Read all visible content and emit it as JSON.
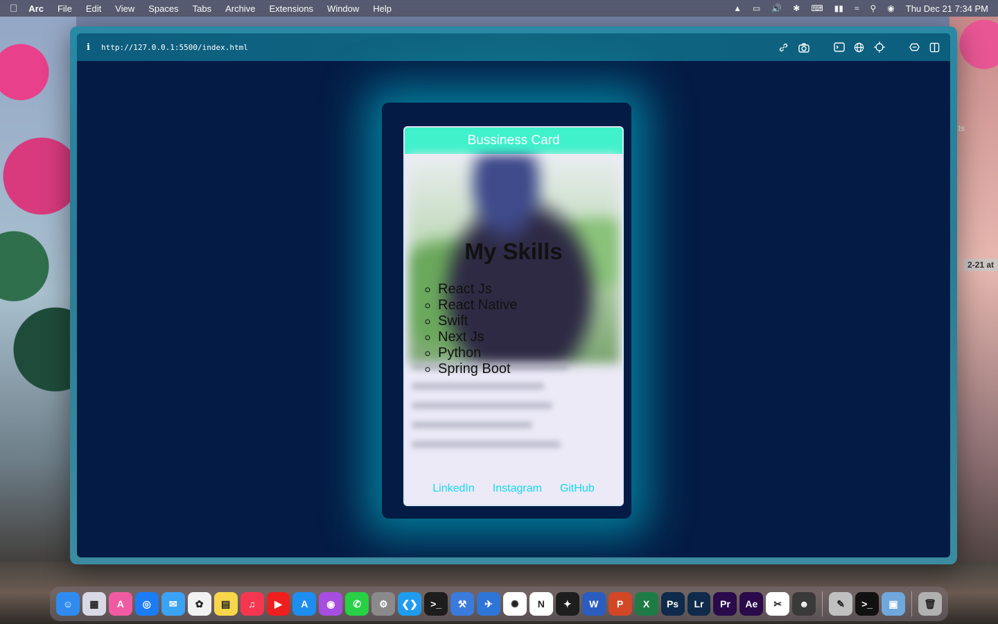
{
  "menubar": {
    "app_name": "Arc",
    "items": [
      "File",
      "Edit",
      "View",
      "Spaces",
      "Tabs",
      "Archive",
      "Extensions",
      "Window",
      "Help"
    ],
    "datetime": "Thu Dec 21  7:34 PM"
  },
  "desktop": {
    "label_partial": "2-21 at",
    "label_partial2": "ts"
  },
  "browser": {
    "info_icon": "i",
    "url": "http://127.0.0.1:5500/index.html"
  },
  "card": {
    "header": "Bussiness Card",
    "skills_title": "My Skills",
    "skills": [
      "React Js",
      "React Native",
      "Swift",
      "Next Js",
      "Python",
      "Spring Boot"
    ],
    "links": [
      "LinkedIn",
      "Instagram",
      "GitHub"
    ]
  },
  "dock": {
    "apps": [
      {
        "name": "finder",
        "color": "#2f8bf0",
        "glyph": "☺"
      },
      {
        "name": "launchpad",
        "color": "#d9d9e6",
        "glyph": "▦"
      },
      {
        "name": "arc",
        "color": "#f05aa0",
        "glyph": "A"
      },
      {
        "name": "safari",
        "color": "#1b7cf5",
        "glyph": "◎"
      },
      {
        "name": "mail",
        "color": "#3aa3f5",
        "glyph": "✉"
      },
      {
        "name": "photos",
        "color": "#f2f2f2",
        "glyph": "✿"
      },
      {
        "name": "notes",
        "color": "#f7d64a",
        "glyph": "▤"
      },
      {
        "name": "music",
        "color": "#f5364f",
        "glyph": "♫"
      },
      {
        "name": "youtube-music",
        "color": "#ef1f1f",
        "glyph": "▶"
      },
      {
        "name": "app-store",
        "color": "#1e8df0",
        "glyph": "A"
      },
      {
        "name": "podcasts",
        "color": "#a64ee0",
        "glyph": "◉"
      },
      {
        "name": "whatsapp",
        "color": "#27d045",
        "glyph": "✆"
      },
      {
        "name": "system-settings",
        "color": "#8a8a8a",
        "glyph": "⚙"
      },
      {
        "name": "vscode",
        "color": "#1f9cf0",
        "glyph": "❮❯"
      },
      {
        "name": "terminal-app",
        "color": "#1d1d1d",
        "glyph": ">_"
      },
      {
        "name": "xcode",
        "color": "#3b7bdc",
        "glyph": "⚒"
      },
      {
        "name": "simulator",
        "color": "#2e75d8",
        "glyph": "✈"
      },
      {
        "name": "chatgpt",
        "color": "#ffffff",
        "glyph": "✺"
      },
      {
        "name": "notion",
        "color": "#ffffff",
        "glyph": "N"
      },
      {
        "name": "figma",
        "color": "#1e1e1e",
        "glyph": "✦"
      },
      {
        "name": "word",
        "color": "#2b5cc0",
        "glyph": "W"
      },
      {
        "name": "powerpoint",
        "color": "#d24726",
        "glyph": "P"
      },
      {
        "name": "excel",
        "color": "#1f7b45",
        "glyph": "X"
      },
      {
        "name": "photoshop",
        "color": "#0f2a4a",
        "glyph": "Ps"
      },
      {
        "name": "lightroom",
        "color": "#0f2a4a",
        "glyph": "Lr"
      },
      {
        "name": "premiere",
        "color": "#2a0a4a",
        "glyph": "Pr"
      },
      {
        "name": "after-effects",
        "color": "#2a0a4a",
        "glyph": "Ae"
      },
      {
        "name": "capcut",
        "color": "#ffffff",
        "glyph": "✂"
      },
      {
        "name": "avatar-app",
        "color": "#3a3a3a",
        "glyph": "☻"
      },
      {
        "name": "pen-app",
        "color": "#c0c0c0",
        "glyph": "✎"
      },
      {
        "name": "terminal",
        "color": "#111111",
        "glyph": ">_"
      },
      {
        "name": "preview",
        "color": "#6fa8dc",
        "glyph": "▣"
      },
      {
        "name": "trash",
        "color": "#b0b0b0",
        "glyph": "🗑"
      }
    ]
  }
}
